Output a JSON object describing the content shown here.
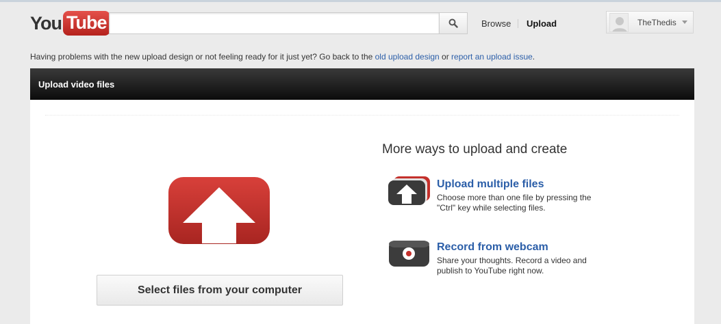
{
  "header": {
    "logo_you": "You",
    "logo_tube": "Tube",
    "search": {
      "value": "",
      "placeholder": ""
    },
    "nav": {
      "browse": "Browse",
      "upload": "Upload"
    },
    "user": {
      "name": "TheThedis"
    }
  },
  "notice": {
    "text_before": "Having problems with the new upload design or not feeling ready for it just yet? Go back to the ",
    "link_old_design": "old upload design",
    "text_middle": " or ",
    "link_report_issue": "report an upload issue",
    "text_after": "."
  },
  "panel": {
    "title": "Upload video files",
    "select_files_label": "Select files from your computer",
    "more_ways": {
      "title": "More ways to upload and create",
      "options": [
        {
          "title": "Upload multiple files",
          "description": "Choose more than one file by pressing the \"Ctrl\" key while selecting files.",
          "icon": "upload-multiple-icon"
        },
        {
          "title": "Record from webcam",
          "description": "Share your thoughts. Record a video and publish to YouTube right now.",
          "icon": "webcam-record-icon"
        }
      ]
    }
  },
  "colors": {
    "brand_red": "#c4302b",
    "link_blue": "#2b5ea8",
    "header_dark": "#111111",
    "page_bg": "#ebebeb"
  }
}
